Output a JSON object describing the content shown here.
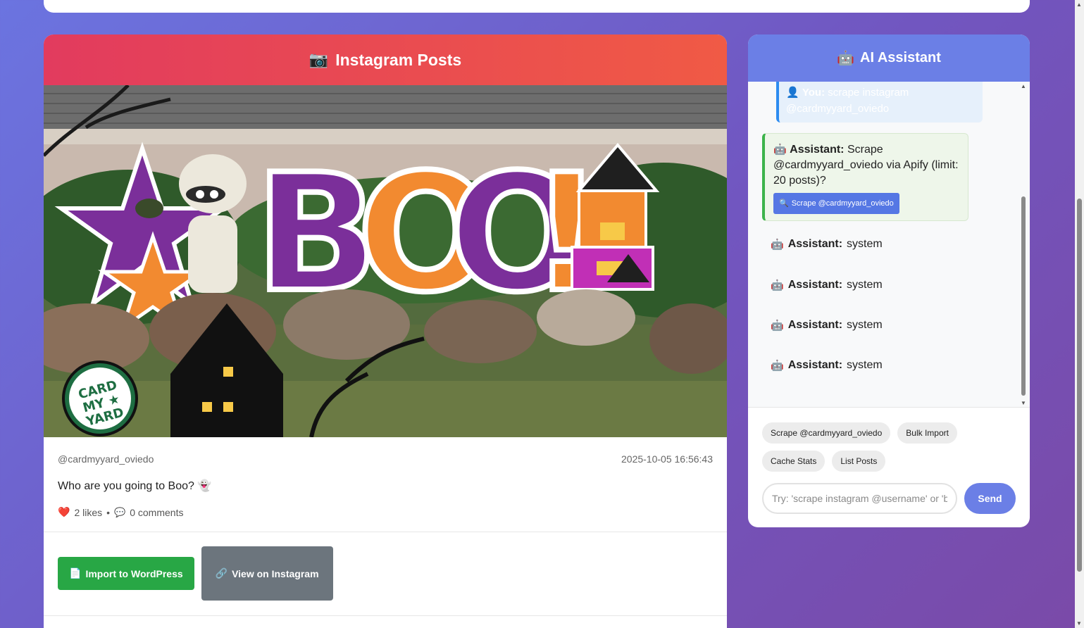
{
  "posts_panel": {
    "title": "Instagram Posts",
    "title_icon": "camera-icon",
    "post": {
      "username": "@cardmyyard_oviedo",
      "timestamp": "2025-10-05 16:56:43",
      "caption": "Who are you going to Boo? 👻",
      "likes": "2 likes",
      "separator": "•",
      "comments": "0 comments",
      "image_sign_text": "BOO!",
      "logo_text": "CARD MY YARD"
    },
    "buttons": {
      "import": "Import to WordPress",
      "view": "View on Instagram"
    }
  },
  "assistant": {
    "title": "AI Assistant",
    "messages": {
      "user": {
        "speaker": "You:",
        "text": "scrape instagram @cardmyyard_oviedo"
      },
      "bot": {
        "speaker": "Assistant:",
        "text": "Scrape @cardmyyard_oviedo via Apify (limit: 20 posts)?",
        "action": "Scrape @cardmyyard_oviedo"
      },
      "system": [
        {
          "speaker": "Assistant:",
          "text": "system"
        },
        {
          "speaker": "Assistant:",
          "text": "system"
        },
        {
          "speaker": "Assistant:",
          "text": "system"
        },
        {
          "speaker": "Assistant:",
          "text": "system"
        }
      ]
    },
    "quick_actions": [
      "Scrape @cardmyyard_oviedo",
      "Bulk Import",
      "Cache Stats",
      "List Posts"
    ],
    "input_placeholder": "Try: 'scrape instagram @username' or 'b",
    "send_label": "Send"
  },
  "colors": {
    "posts_header": "#e23b5e",
    "assistant_header": "#6b7fe6",
    "import_button": "#28a745",
    "view_button": "#6c757d"
  }
}
